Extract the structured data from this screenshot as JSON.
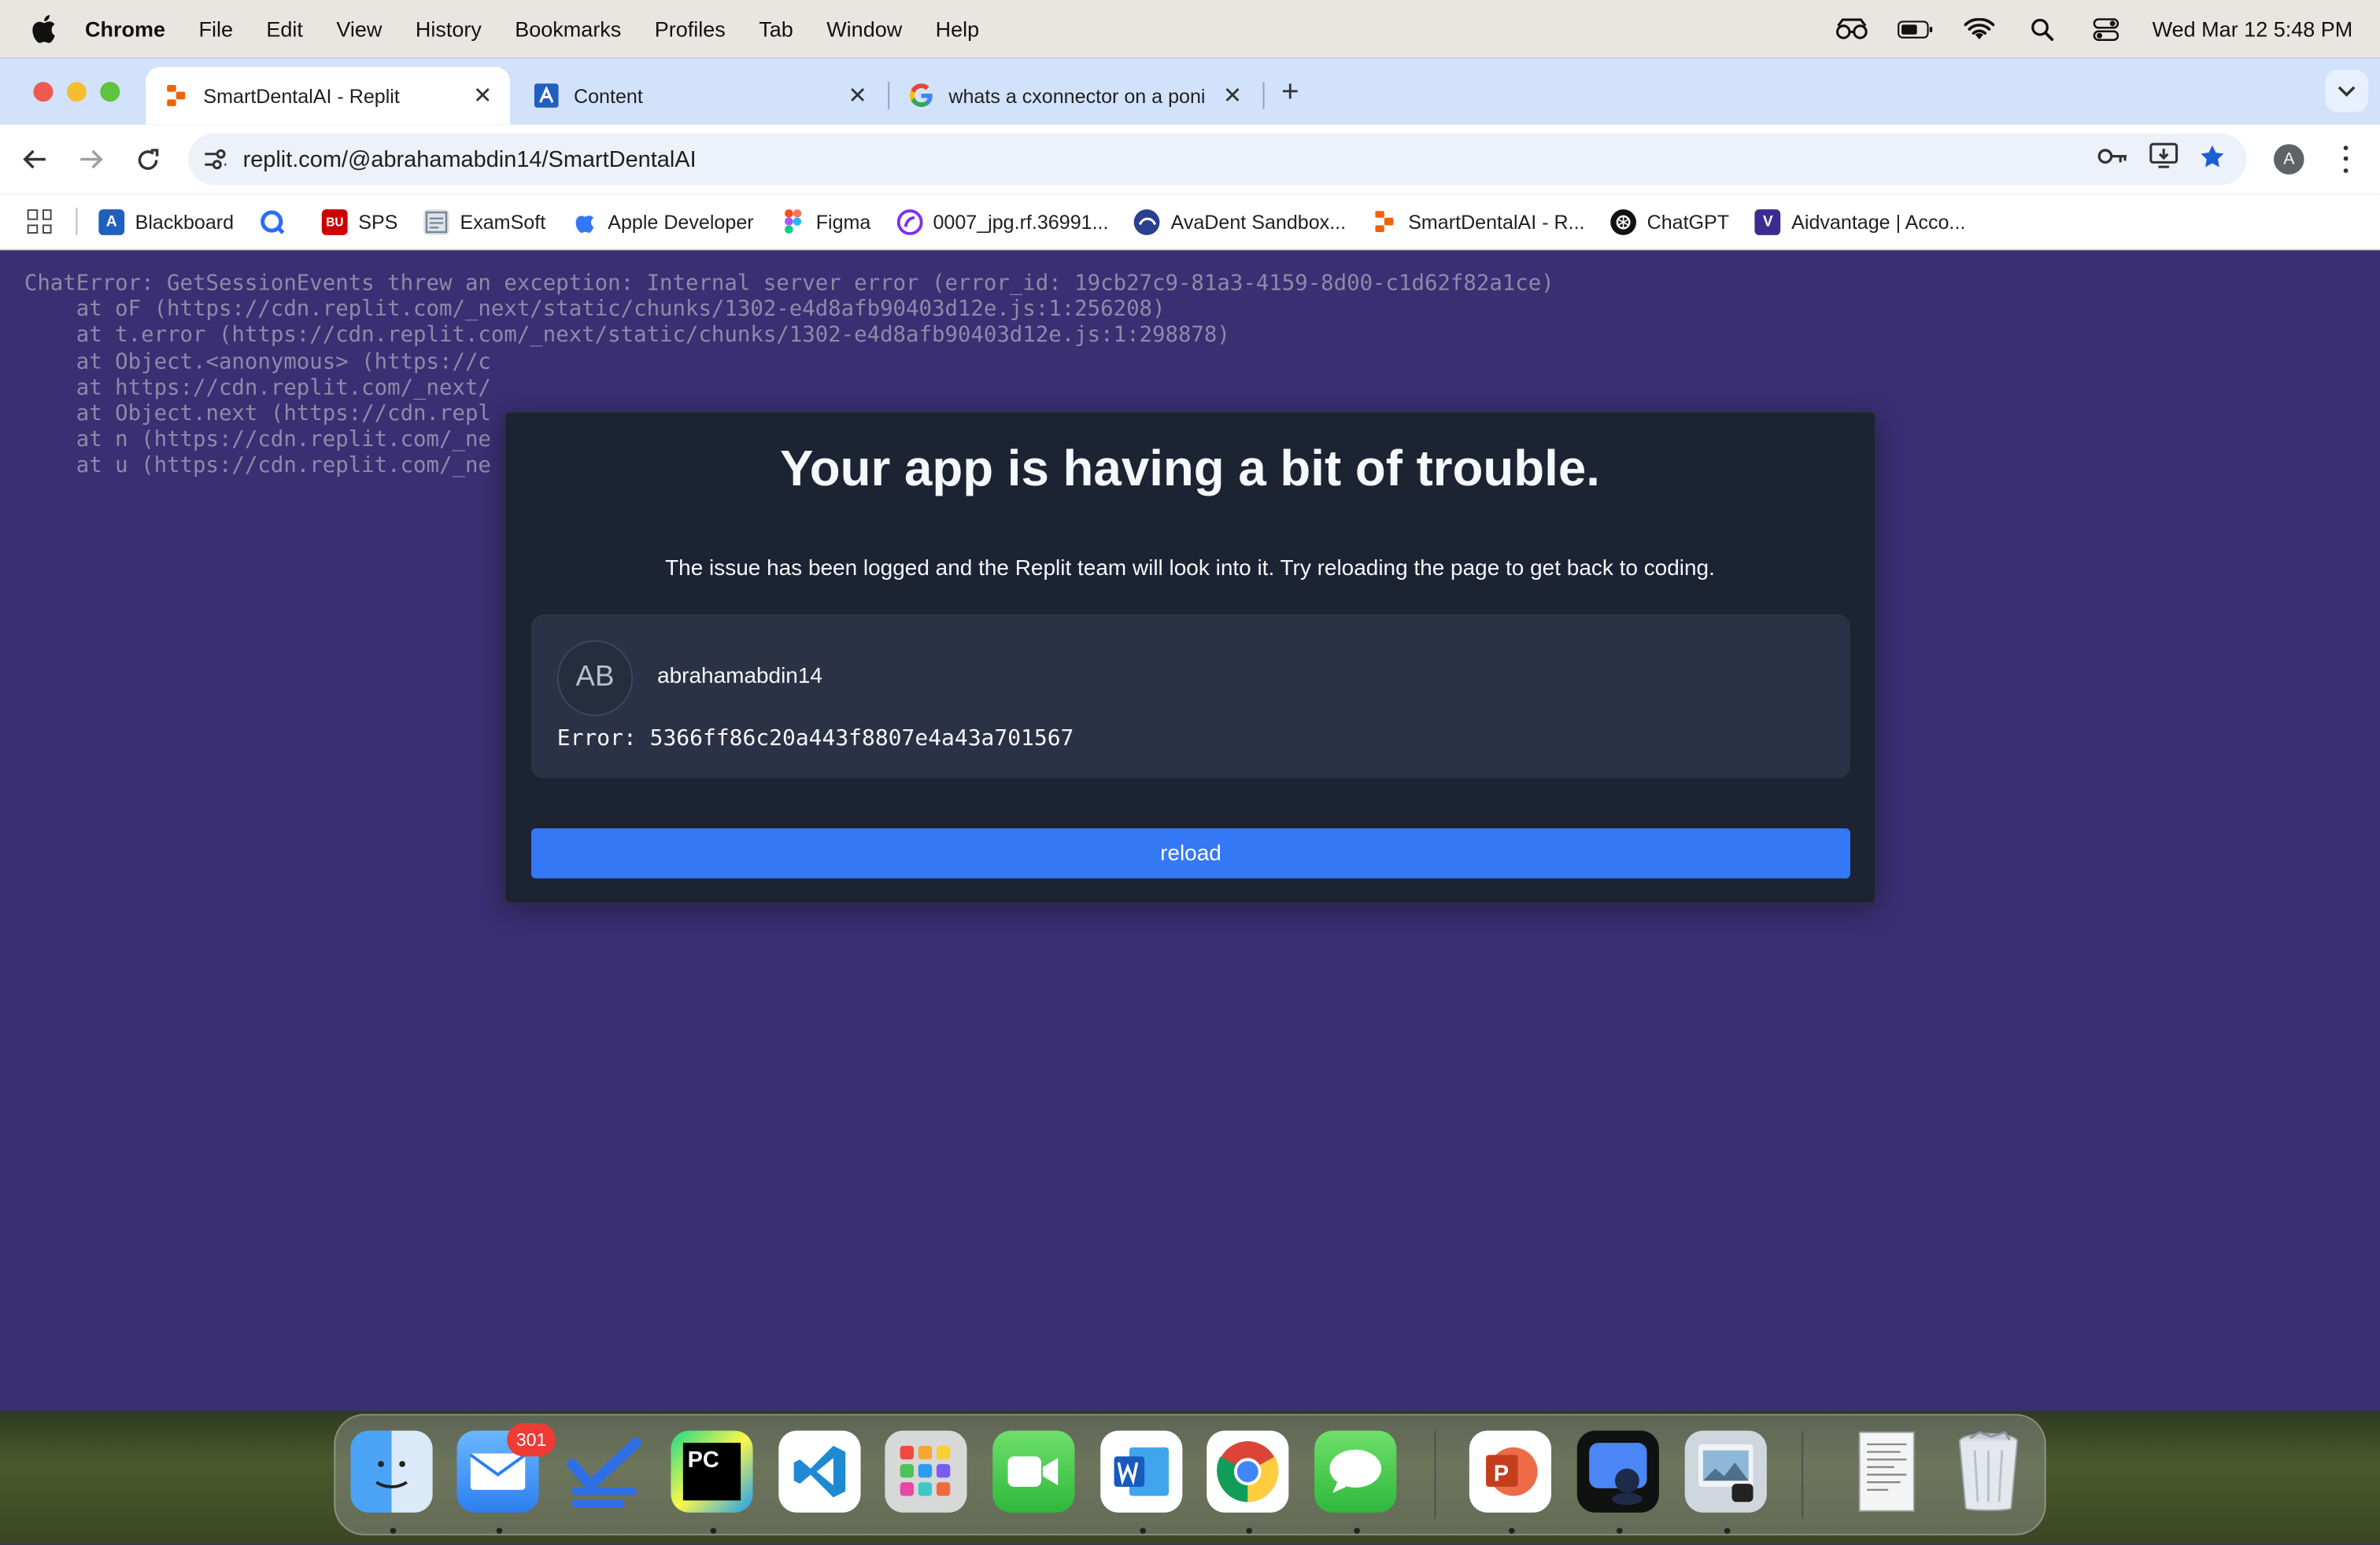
{
  "menubar": {
    "app_name": "Chrome",
    "items": [
      "File",
      "Edit",
      "View",
      "History",
      "Bookmarks",
      "Profiles",
      "Tab",
      "Window",
      "Help"
    ],
    "clock": "Wed Mar 12  5:48 PM"
  },
  "tabs": [
    {
      "title": "SmartDentalAI - Replit",
      "active": true,
      "favicon": "replit-icon"
    },
    {
      "title": "Content",
      "active": false,
      "favicon": "anthology-icon"
    },
    {
      "title": "whats a cxonnector on a poni",
      "active": false,
      "favicon": "google-icon"
    }
  ],
  "toolbar": {
    "url": "replit.com/@abrahamabdin14/SmartDentalAI",
    "profile_initial": "A"
  },
  "bookmarks": [
    {
      "label": "Blackboard",
      "icon": "blackboard-icon",
      "color": "#1f5fbf"
    },
    {
      "label": "",
      "icon": "q-icon",
      "color": "#2b6bff"
    },
    {
      "label": "SPS",
      "icon": "bu-icon",
      "color": "#cc0000"
    },
    {
      "label": "ExamSoft",
      "icon": "examsoft-icon",
      "color": "#7a8797"
    },
    {
      "label": "Apple Developer",
      "icon": "apple-dev-icon",
      "color": "#3478f6"
    },
    {
      "label": "Figma",
      "icon": "figma-icon",
      "color": "#f24e1e"
    },
    {
      "label": "0007_jpg.rf.36991...",
      "icon": "roboflow-icon",
      "color": "#7b2ff7"
    },
    {
      "label": "AvaDent Sandbox...",
      "icon": "avadent-icon",
      "color": "#2a3f8f"
    },
    {
      "label": "SmartDentalAI - R...",
      "icon": "replit-icon",
      "color": "#f26207"
    },
    {
      "label": "ChatGPT",
      "icon": "chatgpt-icon",
      "color": "#111111"
    },
    {
      "label": "Aidvantage | Acco...",
      "icon": "aidvantage-icon",
      "color": "#3a2d8f"
    }
  ],
  "stack_trace": [
    "ChatError: GetSessionEvents threw an exception: Internal server error (error_id: 19cb27c9-81a3-4159-8d00-c1d62f82a1ce)",
    "    at oF (https://cdn.replit.com/_next/static/chunks/1302-e4d8afb90403d12e.js:1:256208)",
    "    at t.error (https://cdn.replit.com/_next/static/chunks/1302-e4d8afb90403d12e.js:1:298878)",
    "    at Object.<anonymous> (https://c",
    "    at https://cdn.replit.com/_next/",
    "    at Object.next (https://cdn.repl",
    "    at n (https://cdn.replit.com/_ne",
    "    at u (https://cdn.replit.com/_ne"
  ],
  "modal": {
    "title": "Your app is having a bit of trouble.",
    "description": "The issue has been logged and the Replit team will look into it. Try reloading the page to get back to coding.",
    "avatar_initials": "AB",
    "username": "abrahamabdin14",
    "error_text": "Error: 5366ff86c20a443f8807e4a43a701567",
    "reload_label": "reload"
  },
  "dock": {
    "mail_badge": "301",
    "apps": [
      "finder-icon",
      "mail-icon",
      "tasks-icon",
      "pycharm-icon",
      "vscode-icon",
      "launchpad-icon",
      "facetime-icon",
      "word-icon",
      "chrome-icon",
      "messages-icon",
      "powerpoint-icon",
      "screen-sharing-icon",
      "preview-icon",
      "document-icon",
      "trash-icon"
    ]
  },
  "colors": {
    "page_background": "#3a2f73",
    "modal_background": "#1c2333",
    "card_background": "#2b3245",
    "reload_button": "#3478f6",
    "tabstrip": "#d3e2fb"
  }
}
